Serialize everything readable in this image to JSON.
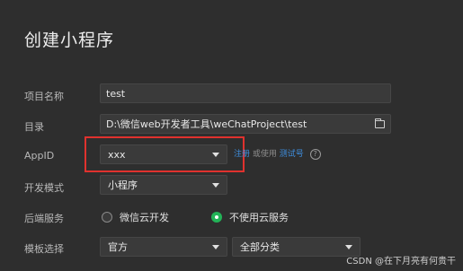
{
  "title": "创建小程序",
  "labels": {
    "project_name": "项目名称",
    "directory": "目录",
    "appid": "AppID",
    "dev_mode": "开发模式",
    "backend_service": "后端服务",
    "template_select": "模板选择"
  },
  "fields": {
    "project_name_value": "test",
    "directory_value": "D:\\微信web开发者工具\\weChatProject\\test",
    "appid_value": "xxx",
    "dev_mode_value": "小程序"
  },
  "appid_links": {
    "register": "注册",
    "or_use": "或使用",
    "test_account": "测试号",
    "help": "?"
  },
  "backend": {
    "option1": "微信云开发",
    "option2": "不使用云服务",
    "selected": "不使用云服务"
  },
  "template": {
    "source_value": "官方",
    "category_value": "全部分类"
  },
  "watermark": "CSDN @在下月亮有何贵干",
  "colors": {
    "background": "#2e2e2e",
    "highlight_border": "#e0322e",
    "link": "#3f8fe0",
    "radio_selected": "#22b357"
  }
}
